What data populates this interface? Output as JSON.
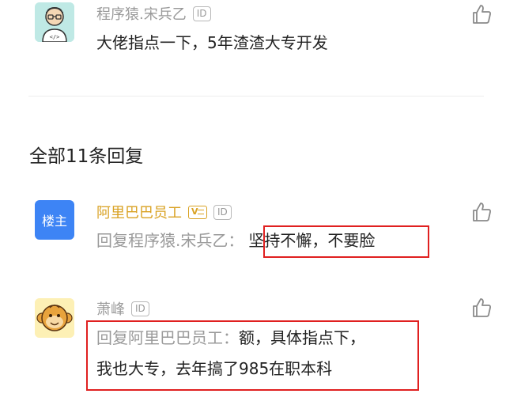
{
  "post": {
    "author": "程序猿.宋兵乙",
    "id_badge": "ID",
    "text": "大佬指点一下，5年渣渣大专开发"
  },
  "replies_header": "全部11条回复",
  "replies": [
    {
      "author": "阿里巴巴员工",
      "id_badge": "ID",
      "owner_badge": "楼主",
      "prefix": "回复程序猿.宋兵乙：",
      "text": "坚持不懈，不要脸"
    },
    {
      "author": "萧峰",
      "id_badge": "ID",
      "prefix": "回复阿里巴巴员工：",
      "text_line1": "额，具体指点下，",
      "text_line2": "我也大专，去年搞了985在职本科"
    }
  ],
  "colors": {
    "highlight_box": "#e02020",
    "owner_badge_bg": "#3d84f5",
    "vip_name": "#d9a223",
    "muted": "#9a9a9a"
  },
  "icons": [
    "coder-avatar-icon",
    "thumbs-up-icon",
    "vip-card-icon",
    "monkey-avatar-icon"
  ]
}
